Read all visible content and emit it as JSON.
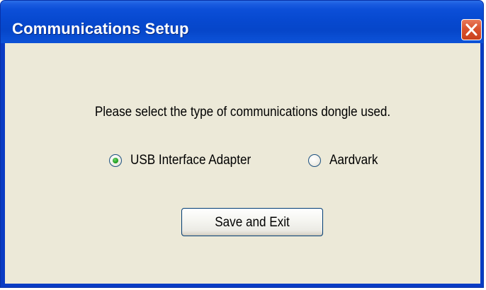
{
  "window": {
    "title": "Communications Setup",
    "close_icon": "close-icon"
  },
  "dialog": {
    "prompt": "Please select the type of communications dongle used.",
    "options": [
      {
        "label": "USB Interface Adapter",
        "selected": true
      },
      {
        "label": "Aardvark",
        "selected": false
      }
    ],
    "save_label": "Save and Exit"
  },
  "colors": {
    "titlebar": "#0749d0",
    "client": "#ece9d8",
    "close_button": "#d9522e",
    "radio_selected": "#21a121"
  }
}
